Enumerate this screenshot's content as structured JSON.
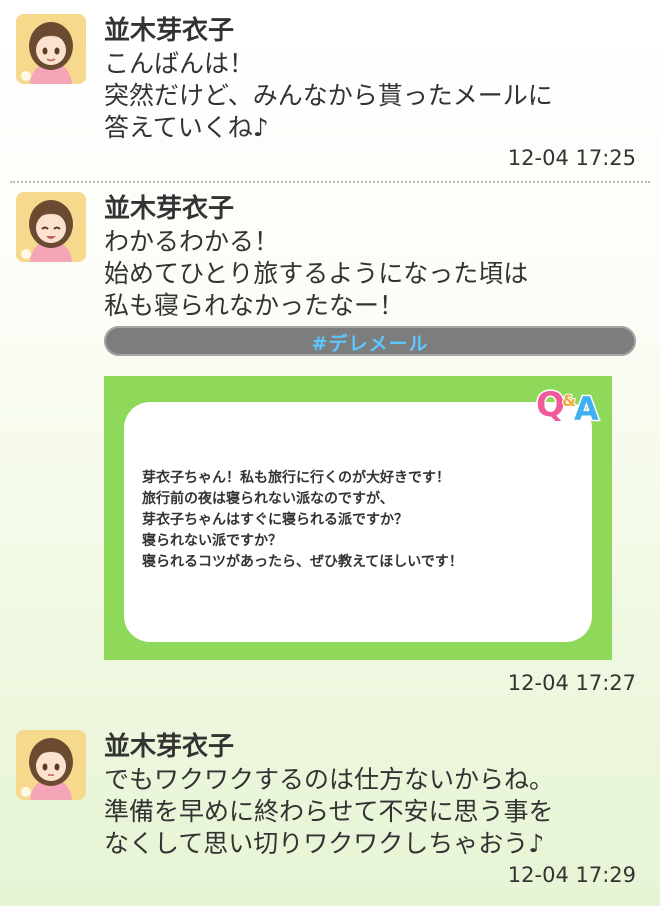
{
  "posts": [
    {
      "author": "並木芽衣子",
      "lines": [
        "こんばんは！",
        "突然だけど、みんなから貰ったメールに",
        "答えていくね♪"
      ],
      "timestamp": "12-04 17:25"
    },
    {
      "author": "並木芽衣子",
      "lines": [
        "わかるわかる！",
        "始めてひとり旅するようになった頃は",
        "私も寝られなかったなー！"
      ],
      "tag": "#デレメール",
      "card": {
        "badge_q": "Q",
        "badge_and": "&",
        "badge_a": "A",
        "lines": [
          "芽衣子ちゃん！私も旅行に行くのが大好きです！",
          "旅行前の夜は寝られない派なのですが、",
          "芽衣子ちゃんはすぐに寝られる派ですか？",
          "寝られない派ですか？",
          "寝られるコツがあったら、ぜひ教えてほしいです！"
        ]
      },
      "timestamp": "12-04 17:27"
    },
    {
      "author": "並木芽衣子",
      "lines": [
        "でもワクワクするのは仕方ないからね。",
        "準備を早めに終わらせて不安に思う事を",
        "なくして思い切りワクワクしちゃおう♪"
      ],
      "timestamp": "12-04 17:29"
    }
  ],
  "colors": {
    "card_green": "#8ed85a",
    "tag_bar": "#7d7d7d",
    "tag_text": "#5cc8ff",
    "badge_pink": "#f05a9a",
    "badge_blue": "#3fb0f0"
  }
}
